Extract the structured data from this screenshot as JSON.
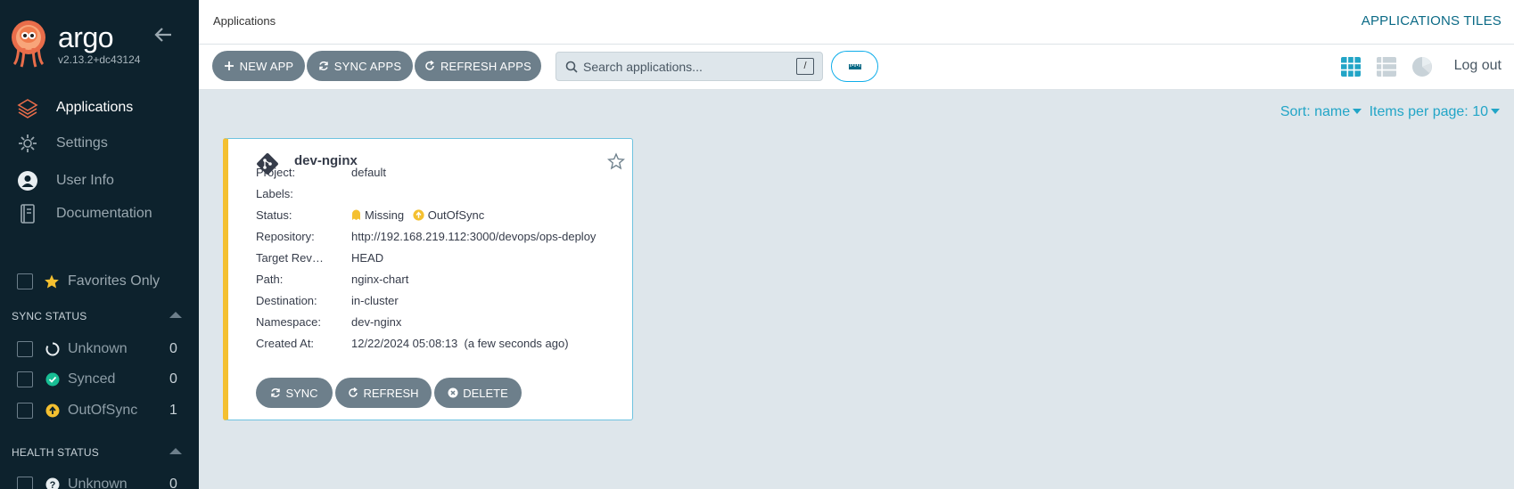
{
  "app": {
    "brand": "argo",
    "version": "v2.13.2+dc43124"
  },
  "sidebar": {
    "nav": [
      {
        "label": "Applications",
        "icon": "layers-icon",
        "active": true
      },
      {
        "label": "Settings",
        "icon": "gear-icon"
      },
      {
        "label": "User Info",
        "icon": "user-icon"
      },
      {
        "label": "Documentation",
        "icon": "book-icon"
      }
    ],
    "favorites_label": "Favorites Only",
    "sync_status": {
      "title": "SYNC STATUS",
      "items": [
        {
          "label": "Unknown",
          "count": "0",
          "icon": "circle-notch-icon"
        },
        {
          "label": "Synced",
          "count": "0",
          "icon": "check-circle-icon"
        },
        {
          "label": "OutOfSync",
          "count": "1",
          "icon": "arrow-up-circle-icon"
        }
      ]
    },
    "health_status": {
      "title": "HEALTH STATUS",
      "items": [
        {
          "label": "Unknown",
          "count": "0",
          "icon": "question-circle-icon"
        }
      ]
    }
  },
  "header": {
    "breadcrumb": "Applications",
    "view_title": "APPLICATIONS TILES"
  },
  "toolbar": {
    "new_app": "NEW APP",
    "sync_apps": "SYNC APPS",
    "refresh_apps": "REFRESH APPS",
    "search_placeholder": "Search applications...",
    "search_shortcut": "/",
    "logout": "Log out"
  },
  "sort": {
    "sort_label": "Sort: name",
    "items_per_page": "Items per page: 10"
  },
  "app_card": {
    "name": "dev-nginx",
    "fields": [
      {
        "key": "Project:",
        "value": "default"
      },
      {
        "key": "Labels:",
        "value": ""
      },
      {
        "key": "Status:",
        "value": ""
      },
      {
        "key": "Repository:",
        "value": "http://192.168.219.112:3000/devops/ops-deploy"
      },
      {
        "key": "Target Revision:",
        "value": "HEAD"
      },
      {
        "key": "Path:",
        "value": "nginx-chart"
      },
      {
        "key": "Destination:",
        "value": "in-cluster"
      },
      {
        "key": "Namespace:",
        "value": "dev-nginx"
      },
      {
        "key": "Created At:",
        "value": "12/22/2024 05:08:13  (a few seconds ago)"
      }
    ],
    "health_status": "Missing",
    "sync_status": "OutOfSync",
    "buttons": {
      "sync": "SYNC",
      "refresh": "REFRESH",
      "delete": "DELETE"
    }
  },
  "colors": {
    "sidebar": "#0d222d",
    "accent": "#22a5c7",
    "out_of_sync": "#f4c030",
    "synced": "#18be94",
    "button": "#6d7f8b"
  }
}
